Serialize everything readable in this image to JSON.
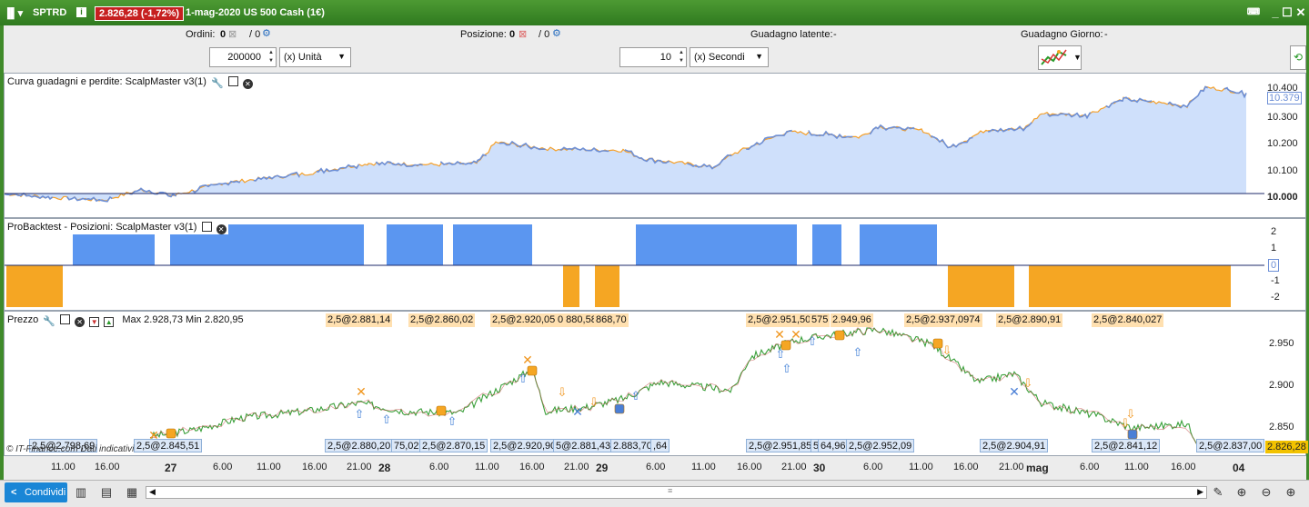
{
  "titlebar": {
    "symbol": "SPTRD",
    "info_icon": "info-icon",
    "price_change": "2.826,28 (-1,72%)",
    "instrument": "1-mag-2020 US 500 Cash (1€)"
  },
  "toolbar": {
    "orders_label": "Ordini:",
    "orders_value": "0",
    "orders_total": "/ 0",
    "positions_label": "Posizione:",
    "positions_value": "0",
    "positions_total": "/ 0",
    "latent_gain_label": "Guadagno latente:",
    "latent_gain_value": "-",
    "day_gain_label": "Guadagno Giorno:",
    "day_gain_value": "-",
    "quantity_value": "200000",
    "quantity_unit": "(x) Unità",
    "time_value": "10",
    "time_unit": "(x) Secondi"
  },
  "panels": {
    "equity_label": "Curva guadagni e perdite: ScalpMaster v3(1)",
    "positions_label": "ProBacktest - Posizioni: ScalpMaster v3(1)",
    "price_label": "Prezzo",
    "price_extra": "Max 2.928,73 Min 2.820,95",
    "watermark": "© IT-Finance.com Dati indicativi"
  },
  "equity_axis": [
    "10.400",
    "10.379",
    "10.300",
    "10.200",
    "10.100",
    "10.000"
  ],
  "positions_axis": [
    "2",
    "1",
    "0",
    "-1",
    "-2"
  ],
  "price_axis": [
    "2.950",
    "2.900",
    "2.850",
    "2.826,28"
  ],
  "time_axis": [
    "11.00",
    "16.00",
    "27",
    "6.00",
    "11.00",
    "16.00",
    "21.00",
    "28",
    "6.00",
    "11.00",
    "16.00",
    "21.00",
    "29",
    "6.00",
    "11.00",
    "16.00",
    "21.00",
    "30",
    "6.00",
    "11.00",
    "16.00",
    "21.00",
    "mag",
    "6.00",
    "11.00",
    "16.00",
    "04"
  ],
  "top_tags": [
    "2,5@2.881,14",
    "2,5@2.860,02",
    "2,5@2.920,05",
    "0 880,58",
    "868,70",
    "2,5@2.951,50",
    "575",
    "2.949,96",
    "2,5@2.937,0974",
    "2,5@2.890,91",
    "2,5@2.840,027"
  ],
  "bottom_tags": [
    "2,5@2.798,69",
    "2,5@2.845,51",
    "2,5@2.880,20",
    "75,02",
    "2,5@2.870,15",
    "2,5@2.920,90",
    "5@2.881,43",
    "2.883,70",
    ",64",
    "2,5@2.951,85",
    "5",
    "64,96",
    "2,5@2.952,09",
    "2,5@2.904,91",
    "2,5@2.841,12",
    "2,5@2.837,00"
  ],
  "bottombar": {
    "share_label": "Condividi"
  },
  "colors": {
    "accent_green": "#3f8a2a",
    "equity_line": "#6d8fd6",
    "equity_fill": "#cfe0fb",
    "equity_flat": "#f5a02a",
    "long": "#5b96f0",
    "short": "#f5a623",
    "price_badge": "#c62020"
  }
}
